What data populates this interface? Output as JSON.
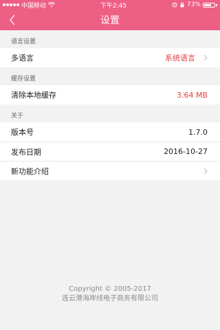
{
  "status_bar": {
    "carrier": "中国移动",
    "time": "下午2:45",
    "battery_percent": "73%",
    "battery_level": 0.73,
    "icons": [
      "signal-dots-icon",
      "wifi-icon",
      "alarm-icon",
      "orientation-lock-icon",
      "battery-icon"
    ]
  },
  "nav": {
    "title": "设置",
    "back_icon": "chevron-left-icon"
  },
  "sections": {
    "language": {
      "header": "语言设置",
      "row_label": "多语言",
      "row_value": "系统语言"
    },
    "cache": {
      "header": "缓存设置",
      "row_label": "清除本地缓存",
      "row_value": "3.64 MB"
    },
    "about": {
      "header": "关于",
      "version_label": "版本号",
      "version_value": "1.7.0",
      "release_label": "发布日期",
      "release_value": "2016-10-27",
      "features_label": "新功能介绍"
    }
  },
  "footer": {
    "copyright": "Copyright © 2005-2017",
    "company": "连云港海岸线电子商务有限公司"
  },
  "colors": {
    "brand": "#ee5f86",
    "accent": "#e53e3e",
    "background": "#f2f2f2"
  }
}
